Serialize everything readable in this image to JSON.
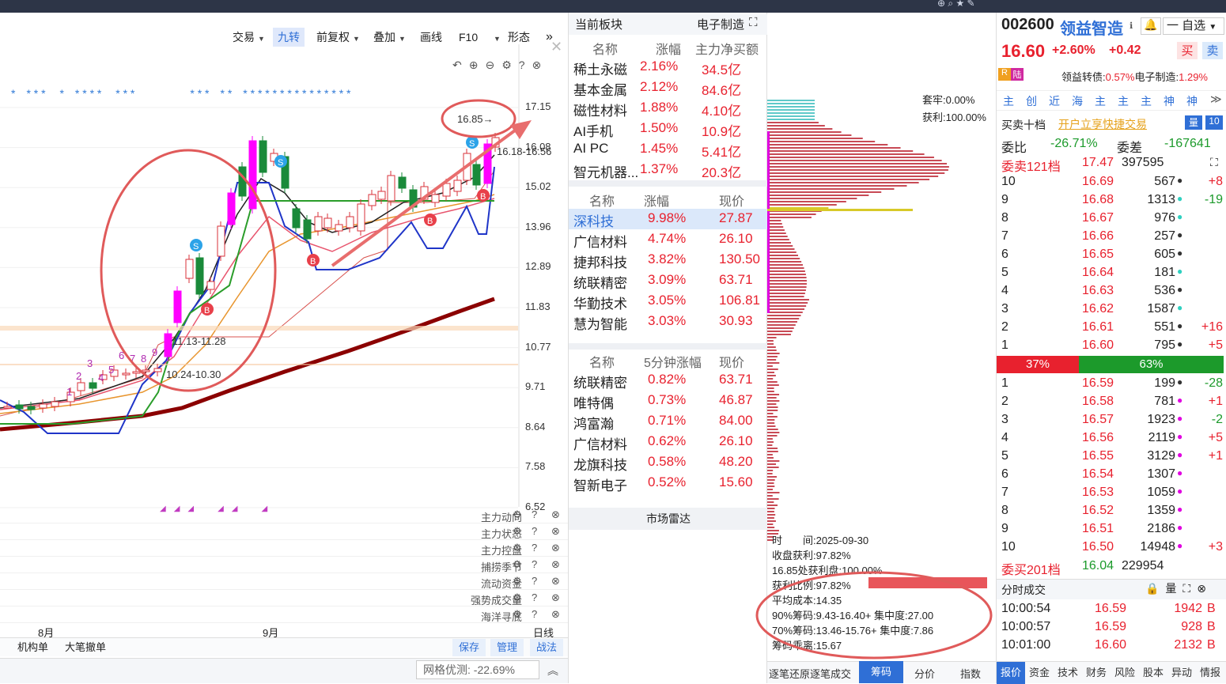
{
  "toolbar": {
    "items": [
      "交易",
      "九转",
      "前复权",
      "叠加",
      "画线",
      "F10",
      "形态"
    ]
  },
  "chart": {
    "yticks": [
      "17.15",
      "16.08",
      "15.02",
      "13.96",
      "12.89",
      "11.83",
      "10.77",
      "9.71",
      "8.64",
      "7.58",
      "6.52"
    ],
    "months": [
      "8月",
      "9月"
    ],
    "high_label": "16.85→",
    "price_range_1": "16.18-16.56",
    "price_range_2": "11.13-11.28",
    "price_range_3": "10.24-10.30",
    "nine_labels": [
      "1",
      "2",
      "3",
      "4",
      "5",
      "6",
      "7",
      "8",
      "9"
    ],
    "stamp": "S",
    "buy_stamp": "B",
    "period": "日线"
  },
  "indicators": [
    "主力动向",
    "主力状态",
    "主力控盘",
    "捕捞季节",
    "流动资金",
    "强势成交量",
    "海洋寻底"
  ],
  "bottom_tabs": [
    "机构单",
    "大笔撤单"
  ],
  "bottom_buttons": [
    "保存",
    "管理",
    "战法"
  ],
  "grid": {
    "label": "网格优测:",
    "value": "-22.69%"
  },
  "sector": {
    "title": "当前板块",
    "name": "电子制造",
    "header": [
      "名称",
      "涨幅",
      "主力净买额"
    ],
    "rows": [
      [
        "稀土永磁",
        "2.16%",
        "34.5亿"
      ],
      [
        "基本金属",
        "2.12%",
        "84.6亿"
      ],
      [
        "磁性材料",
        "1.88%",
        "4.10亿"
      ],
      [
        "AI手机",
        "1.50%",
        "10.9亿"
      ],
      [
        "AI PC",
        "1.45%",
        "5.41亿"
      ],
      [
        "智元机器...",
        "1.37%",
        "20.3亿"
      ]
    ]
  },
  "stocks": {
    "header": [
      "名称",
      "涨幅",
      "现价"
    ],
    "rows": [
      [
        "深科技",
        "9.98%",
        "27.87"
      ],
      [
        "广信材料",
        "4.74%",
        "26.10"
      ],
      [
        "捷邦科技",
        "3.82%",
        "130.50"
      ],
      [
        "统联精密",
        "3.09%",
        "63.71"
      ],
      [
        "华勤技术",
        "3.05%",
        "106.81"
      ],
      [
        "慧为智能",
        "3.03%",
        "30.93"
      ]
    ]
  },
  "fast": {
    "header": [
      "名称",
      "5分钟涨幅",
      "现价"
    ],
    "rows": [
      [
        "统联精密",
        "0.82%",
        "63.71"
      ],
      [
        "唯特偶",
        "0.73%",
        "46.87"
      ],
      [
        "鸿富瀚",
        "0.71%",
        "84.00"
      ],
      [
        "广信材料",
        "0.62%",
        "26.10"
      ],
      [
        "龙旗科技",
        "0.58%",
        "48.20"
      ],
      [
        "智新电子",
        "0.52%",
        "15.60"
      ]
    ]
  },
  "radar": "市场雷达",
  "chips": {
    "taolao": "套牢:0.00%",
    "huoli": "获利:100.00%",
    "lines": [
      "时　　间:2025-09-30",
      "收盘获利:97.82%",
      "16.85处获利盘:100.00%",
      "获利比例:97.82%",
      "平均成本:14.35",
      "90%筹码:9.43-16.40+ 集中度:27.00",
      "70%筹码:13.46-15.76+ 集中度:7.86",
      "筹码乖离:15.67"
    ],
    "tabs": [
      "逐笔还原逐笔成交",
      "筹码",
      "分价",
      "指数"
    ]
  },
  "quote": {
    "code": "002600",
    "name": "领益智造",
    "price": "16.60",
    "pct": "+2.60%",
    "chg": "+0.42",
    "buy": "买",
    "sell": "卖",
    "tags": [
      "R",
      "陆"
    ],
    "bond": "领益转债:",
    "bond_pct": "0.57%",
    "sector": "电子制造:",
    "sector_pct": "1.29%",
    "watch": "一 自选",
    "shortcuts": [
      "主",
      "创",
      "近",
      "海",
      "主",
      "主",
      "主",
      "神",
      "神"
    ],
    "tenlevel": "买卖十档",
    "trade_link": "开户立享快捷交易",
    "weibi_l": "委比",
    "weibi": "-26.71%",
    "weicha_l": "委差",
    "weicha": "-167641",
    "sell_total": "委卖121档",
    "sell_total_p": "17.47",
    "sell_total_v": "397595",
    "asks": [
      [
        "10",
        "16.69",
        "567",
        "+8"
      ],
      [
        "9",
        "16.68",
        "1313",
        "-19"
      ],
      [
        "8",
        "16.67",
        "976",
        ""
      ],
      [
        "7",
        "16.66",
        "257",
        ""
      ],
      [
        "6",
        "16.65",
        "605",
        ""
      ],
      [
        "5",
        "16.64",
        "181",
        ""
      ],
      [
        "4",
        "16.63",
        "536",
        ""
      ],
      [
        "3",
        "16.62",
        "1587",
        ""
      ],
      [
        "2",
        "16.61",
        "551",
        "+16"
      ],
      [
        "1",
        "16.60",
        "795",
        "+5"
      ]
    ],
    "bar_left": "37%",
    "bar_right": "63%",
    "bids": [
      [
        "1",
        "16.59",
        "199",
        "-28"
      ],
      [
        "2",
        "16.58",
        "781",
        "+1"
      ],
      [
        "3",
        "16.57",
        "1923",
        "-2"
      ],
      [
        "4",
        "16.56",
        "2119",
        "+5"
      ],
      [
        "5",
        "16.55",
        "3129",
        "+1"
      ],
      [
        "6",
        "16.54",
        "1307",
        ""
      ],
      [
        "7",
        "16.53",
        "1059",
        ""
      ],
      [
        "8",
        "16.52",
        "1359",
        ""
      ],
      [
        "9",
        "16.51",
        "2186",
        ""
      ],
      [
        "10",
        "16.50",
        "14948",
        "+3"
      ]
    ],
    "buy_total": "委买201档",
    "buy_total_p": "16.04",
    "buy_total_v": "229954",
    "tick_title": "分时成交",
    "ticks": [
      [
        "10:00:54",
        "16.59",
        "1942",
        "B"
      ],
      [
        "10:00:57",
        "16.59",
        "928",
        "B"
      ],
      [
        "10:01:00",
        "16.60",
        "2132",
        "B"
      ]
    ],
    "tabs": [
      "报价",
      "资金",
      "技术",
      "财务",
      "风险",
      "股本",
      "异动",
      "情报"
    ]
  }
}
